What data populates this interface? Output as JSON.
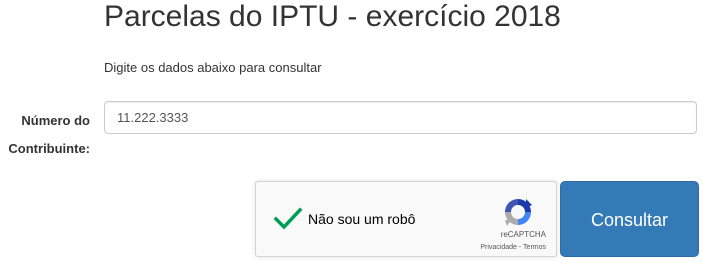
{
  "header": {
    "title": "Parcelas do IPTU - exercício 2018",
    "subtitle": "Digite os dados abaixo para consultar"
  },
  "form": {
    "contributor_label_line1": "Número do",
    "contributor_label_line2": "Contribuinte:",
    "contributor_value": "11.222.3333"
  },
  "recaptcha": {
    "checkbox_label": "Não sou um robô",
    "checked": true,
    "brand": "reCAPTCHA",
    "privacy_link": "Privacidade",
    "separator": " - ",
    "terms_link": "Termos",
    "check_color": "#009e55",
    "icon": "recaptcha-logo-icon"
  },
  "actions": {
    "submit_label": "Consultar",
    "submit_color": "#337ab7"
  }
}
